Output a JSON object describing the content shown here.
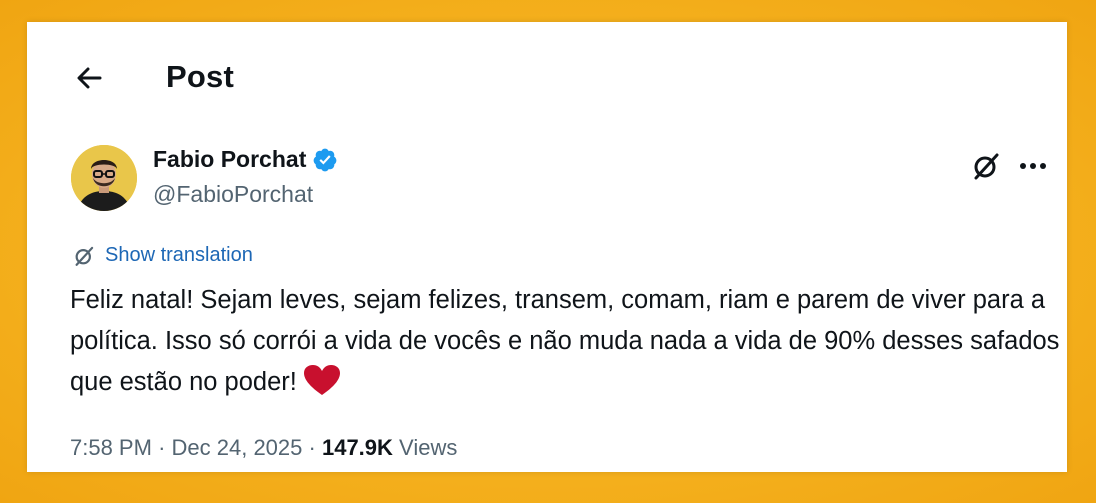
{
  "header": {
    "title": "Post",
    "back_icon": "arrow-left-icon"
  },
  "author": {
    "name": "Fabio Porchat",
    "handle": "@FabioPorchat",
    "verified": true,
    "verified_color": "#1d9bf0"
  },
  "actions": {
    "grok_icon": "grok-icon",
    "more_icon": "more-horizontal-icon"
  },
  "translation": {
    "label": "Show translation",
    "color": "#1d67b5"
  },
  "tweet": {
    "text": "Feliz natal! Sejam leves, sejam felizes, transem, comam, riam e parem de viver para a política. Isso só corrói a vida de vocês e não muda nada a vida de 90% desses safados que estão no poder!",
    "emoji": "red-heart-icon"
  },
  "meta": {
    "time": "7:58 PM",
    "separator": "·",
    "date": "Dec 24, 2025",
    "views_count": "147.9K",
    "views_label": "Views"
  },
  "colors": {
    "background": "#f5b21f",
    "card": "#ffffff",
    "text": "#0f1419",
    "secondary": "#536471"
  }
}
